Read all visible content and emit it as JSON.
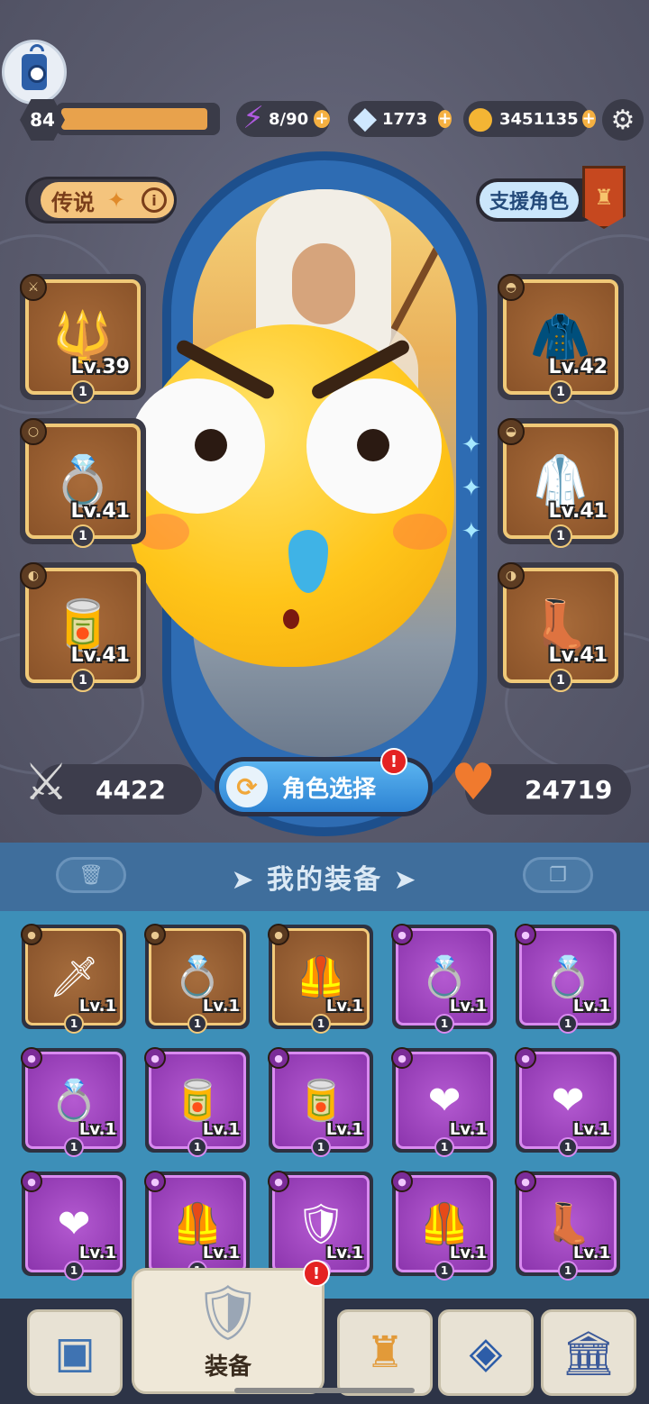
{
  "player": {
    "level": "84",
    "xp_progress_fraction": 0.95
  },
  "resources": {
    "energy": "8/90",
    "gems": "1773",
    "gold": "3451135"
  },
  "hero": {
    "rarity_label": "传说",
    "support_label": "支援角色",
    "attack": "4422",
    "health": "24719",
    "select_button_label": "角色选择",
    "select_alert": "!"
  },
  "equipped": {
    "left": [
      {
        "icon": "staff-icon",
        "type": "sword-icon",
        "level": "Lv.39",
        "count": "1"
      },
      {
        "icon": "ring-icon",
        "type": "ring-slot-icon",
        "level": "Lv.41",
        "count": "1"
      },
      {
        "icon": "bracer-icon",
        "type": "bracer-slot-icon",
        "level": "Lv.41",
        "count": "1"
      }
    ],
    "right": [
      {
        "icon": "hood-icon",
        "type": "helmet-slot-icon",
        "level": "Lv.42",
        "count": "1"
      },
      {
        "icon": "cloak-icon",
        "type": "armor-slot-icon",
        "level": "Lv.41",
        "count": "1"
      },
      {
        "icon": "boots-icon",
        "type": "boots-slot-icon",
        "level": "Lv.41",
        "count": "1"
      }
    ]
  },
  "inventory": {
    "title": "我的装备",
    "items": [
      {
        "icon": "blade-icon",
        "rarity": "brown",
        "level": "Lv.1",
        "count": "1"
      },
      {
        "icon": "gem-ring-icon",
        "rarity": "brown",
        "level": "Lv.1",
        "count": "1"
      },
      {
        "icon": "chest-armor-icon",
        "rarity": "brown",
        "level": "Lv.1",
        "count": "1"
      },
      {
        "icon": "ring-icon",
        "rarity": "purple",
        "level": "Lv.1",
        "count": "1"
      },
      {
        "icon": "ring-icon",
        "rarity": "purple",
        "level": "Lv.1",
        "count": "1"
      },
      {
        "icon": "sapphire-ring-icon",
        "rarity": "purple",
        "level": "Lv.1",
        "count": "1"
      },
      {
        "icon": "bracer-icon",
        "rarity": "purple",
        "level": "Lv.1",
        "count": "1"
      },
      {
        "icon": "green-bracer-icon",
        "rarity": "purple",
        "level": "Lv.1",
        "count": "1"
      },
      {
        "icon": "red-scarf-icon",
        "rarity": "purple",
        "level": "Lv.1",
        "count": "1"
      },
      {
        "icon": "red-scarf-icon",
        "rarity": "purple",
        "level": "Lv.1",
        "count": "1"
      },
      {
        "icon": "red-scarf-icon",
        "rarity": "purple",
        "level": "Lv.1",
        "count": "1"
      },
      {
        "icon": "dark-armor-icon",
        "rarity": "purple",
        "level": "Lv.1",
        "count": "1"
      },
      {
        "icon": "gold-armor-icon",
        "rarity": "purple",
        "level": "Lv.1",
        "count": "1"
      },
      {
        "icon": "dark-armor-icon",
        "rarity": "purple",
        "level": "Lv.1",
        "count": "1"
      },
      {
        "icon": "boots-icon",
        "rarity": "purple",
        "level": "Lv.1",
        "count": "1"
      }
    ]
  },
  "nav": {
    "active_label": "装备",
    "active_alert": "!"
  },
  "colors": {
    "accent_gold": "#f0c978",
    "purple_rarity": "#8c35ad",
    "brown_rarity": "#86512a",
    "xp_bar": "#e8a24c",
    "alert": "#e42222"
  }
}
